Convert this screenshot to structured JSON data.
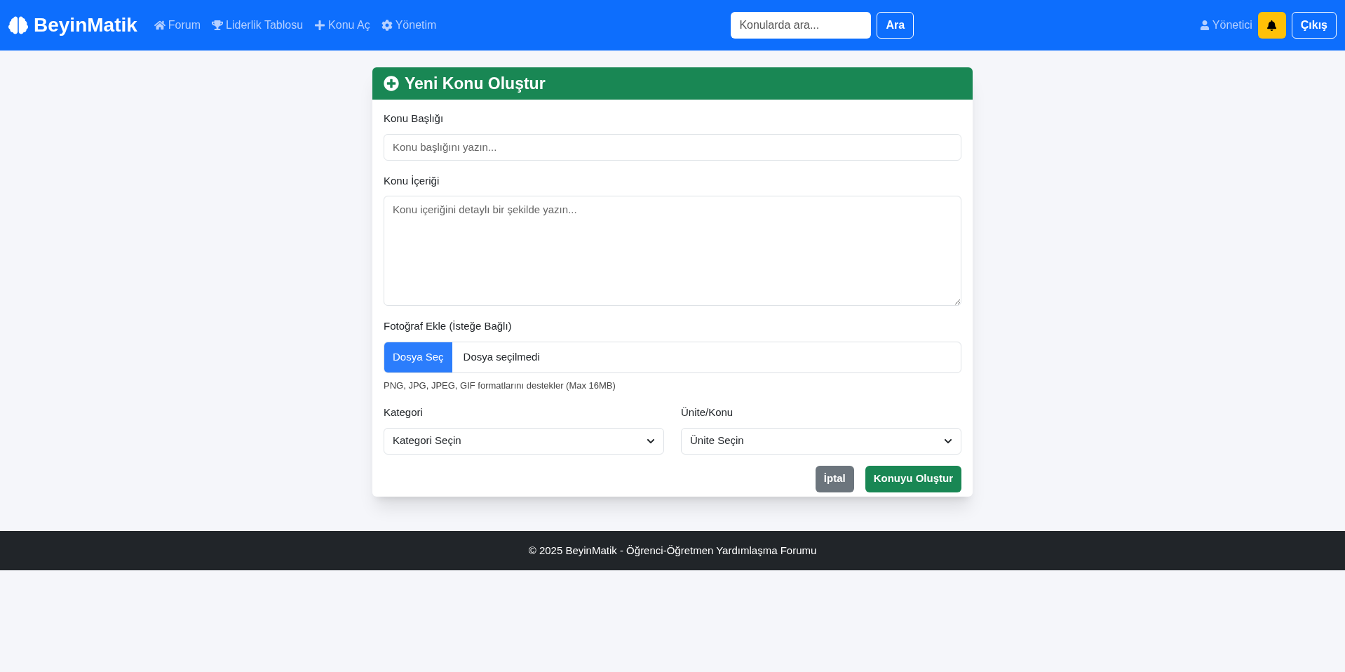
{
  "navbar": {
    "brand": "BeyinMatik",
    "links": [
      {
        "label": "Forum",
        "kind": "home"
      },
      {
        "label": "Liderlik Tablosu",
        "kind": "leaderboard"
      },
      {
        "label": "Konu Aç",
        "kind": "new"
      },
      {
        "label": "Yönetim",
        "kind": "admin"
      }
    ],
    "search": {
      "placeholder": "Konularda ara...",
      "button": "Ara"
    },
    "user": "Yönetici",
    "logout": "Çıkış"
  },
  "card": {
    "title": "Yeni Konu Oluştur",
    "title_field": {
      "label": "Konu Başlığı",
      "placeholder": "Konu başlığını yazın..."
    },
    "content_field": {
      "label": "Konu İçeriği",
      "placeholder": "Konu içeriğini detaylı bir şekilde yazın..."
    },
    "photo_field": {
      "label": "Fotoğraf Ekle (İsteğe Bağlı)",
      "button": "Dosya Seç",
      "status": "Dosya seçilmedi",
      "hint": "PNG, JPG, JPEG, GIF formatlarını destekler (Max 16MB)"
    },
    "selects": [
      {
        "label": "Kategori",
        "value": "Kategori Seçin"
      },
      {
        "label": "Ünite/Konu",
        "value": "Ünite Seçin"
      }
    ],
    "buttons": [
      {
        "label": "İptal",
        "kind": "secondary"
      },
      {
        "label": "Konuyu Oluştur",
        "kind": "primary"
      }
    ]
  },
  "footer": "© 2025 BeyinMatik - Öğrenci-Öğretmen Yardımlaşma Forumu"
}
